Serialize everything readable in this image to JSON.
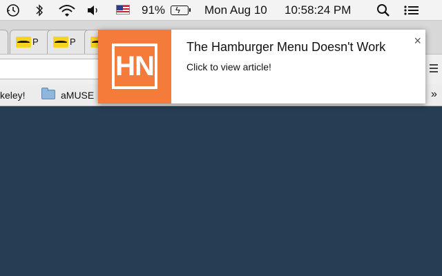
{
  "menubar": {
    "icons": [
      "time-machine-icon",
      "bluetooth-icon",
      "wifi-icon",
      "volume-icon",
      "us-flag-icon",
      "battery-charging-icon",
      "spotlight-search-icon",
      "notification-center-icon"
    ],
    "battery_percent": "91%",
    "date": "Mon Aug 10",
    "time": "10:58:24 PM"
  },
  "tabs": [
    {
      "favicon": "hn-p-favicon",
      "label": "P"
    },
    {
      "favicon": "hn-p-favicon",
      "label": "P"
    },
    {
      "favicon": "hn-p-favicon",
      "label": ""
    }
  ],
  "bookmarks": {
    "items": [
      {
        "label": "keley!"
      },
      {
        "label": "aMUSE",
        "icon": "folder-icon"
      }
    ],
    "overflow": "»"
  },
  "notification": {
    "logo_text": "HN",
    "title": "The Hamburger Menu Doesn't Work",
    "body": "Click to view article!",
    "close": "×"
  },
  "colors": {
    "page_bg": "#263d53",
    "hn_orange": "#f47b39",
    "menubar_bg": "#f4f3f3"
  }
}
